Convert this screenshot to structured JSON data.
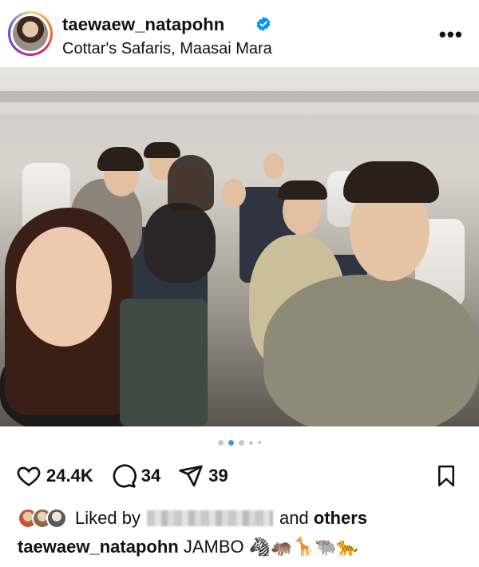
{
  "header": {
    "username": "taewaew_natapohn",
    "location": "Cottar's Safaris, Maasai Mara",
    "more_icon": "more-horizontal-icon",
    "verified": true
  },
  "photo": {
    "pagination": {
      "total": 5,
      "active_index": 1
    }
  },
  "actions": {
    "likes": "24.4K",
    "comments": "34",
    "shares": "39"
  },
  "liked_by": {
    "prefix": "Liked by",
    "connector": "and",
    "others": "others"
  },
  "caption": {
    "username": "taewaew_natapohn",
    "text": "JAMBO",
    "emojis": "🦓🦛🦒🐃🐆"
  },
  "colors": {
    "accent_blue": "#3897f0",
    "verified_blue": "#0095f6",
    "text": "#111111"
  }
}
